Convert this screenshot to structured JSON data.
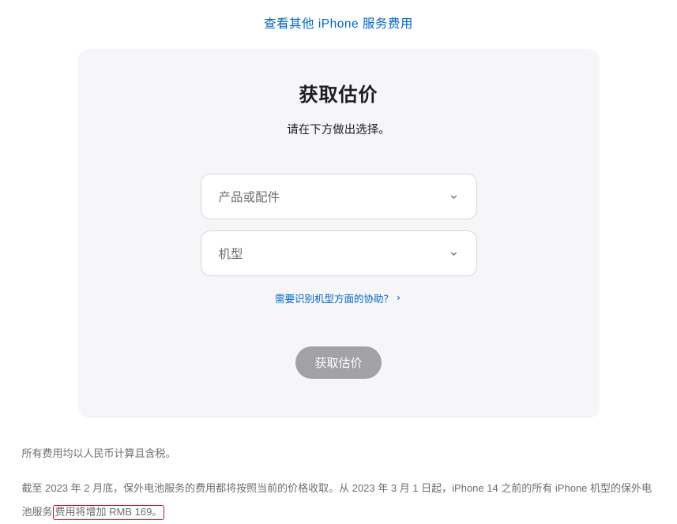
{
  "topLink": "查看其他 iPhone 服务费用",
  "card": {
    "title": "获取估价",
    "subtitle": "请在下方做出选择。",
    "select1": "产品或配件",
    "select2": "机型",
    "helpLink": "需要识别机型方面的协助？",
    "submit": "获取估价"
  },
  "footer": {
    "p1": "所有费用均以人民币计算且含税。",
    "p2a": "截至 2023 年 2 月底，保外电池服务的费用都将按照当前的价格收取。从 2023 年 3 月 1 日起，iPhone 14 之前的所有 iPhone 机型的保外电池服务",
    "p2b": "费用将增加 RMB 169。"
  }
}
